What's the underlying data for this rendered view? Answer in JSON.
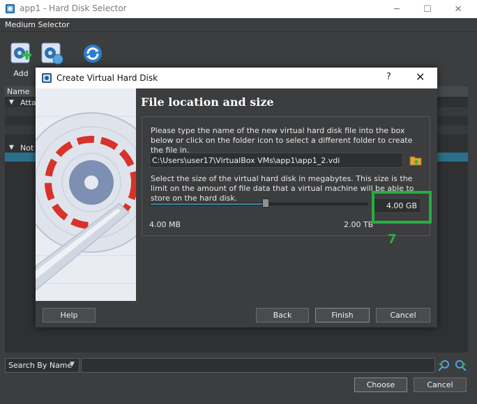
{
  "window": {
    "title": "app1 - Hard Disk Selector",
    "controls": {
      "minimize": "─",
      "maximize": "☐",
      "close": "✕"
    }
  },
  "menubar": {
    "item": "Medium Selector"
  },
  "toolbar": {
    "add_label": "Add"
  },
  "tree": {
    "header": "Name",
    "groups": [
      {
        "label": "Atta",
        "toggle": "▼"
      },
      {
        "label": "Not",
        "toggle": "▼"
      }
    ]
  },
  "search": {
    "mode": "Search By Name",
    "dropdown_glyph": "▼",
    "value": ""
  },
  "footer": {
    "choose_label": "Choose",
    "cancel_label": "Cancel"
  },
  "dialog": {
    "title": "Create Virtual Hard Disk",
    "help_glyph": "?",
    "close_glyph": "✕",
    "heading": "File location and size",
    "location_text": "Please type the name of the new virtual hard disk file into the box below or click on the folder icon to select a different folder to create the file in.",
    "file_path": "C:\\Users\\user17\\VirtualBox VMs\\app1\\app1_2.vdi",
    "size_text": "Select the size of the virtual hard disk in megabytes. This size is the limit on the amount of file data that a virtual machine will be able to store on the hard disk.",
    "size_value": "4.00 GB",
    "slider_fraction": 0.53,
    "min_label": "4.00 MB",
    "max_label": "2.00 TB",
    "buttons": {
      "help": "Help",
      "back": "Back",
      "finish": "Finish",
      "cancel": "Cancel"
    }
  },
  "annotation": {
    "label": "7",
    "color": "#27ae3e"
  }
}
